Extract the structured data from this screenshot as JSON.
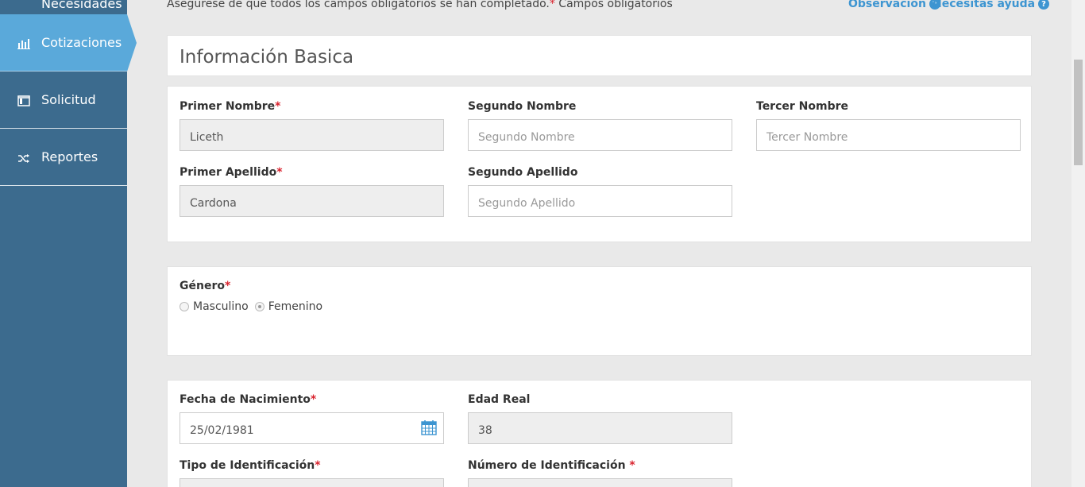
{
  "sidebar": {
    "items": [
      {
        "label": "Necesidades"
      },
      {
        "label": "Cotizaciones",
        "icon": "bar-chart-icon",
        "active": true
      },
      {
        "label": "Solicitud",
        "icon": "window-icon"
      },
      {
        "label": "Reportes",
        "icon": "shuffle-icon"
      }
    ]
  },
  "notice": {
    "text": "Asegúrese de que todos los campos obligatorios se han completado.",
    "req_mark": "*",
    "req_text": " Campos obligatorios"
  },
  "help_links": {
    "observacion": "Observación",
    "ayuda": "Necesitas ayuda",
    "q": "?"
  },
  "basic_info": {
    "title": "Información Basica",
    "primer_nombre": {
      "label": "Primer Nombre",
      "value": "Liceth"
    },
    "segundo_nombre": {
      "label": "Segundo Nombre",
      "placeholder": "Segundo Nombre"
    },
    "tercer_nombre": {
      "label": "Tercer Nombre",
      "placeholder": "Tercer Nombre"
    },
    "primer_apellido": {
      "label": "Primer Apellido",
      "value": "Cardona"
    },
    "segundo_apellido": {
      "label": "Segundo Apellido",
      "placeholder": "Segundo Apellido"
    },
    "req": "*"
  },
  "genero": {
    "label": "Género",
    "options": [
      {
        "label": "Masculino",
        "selected": false
      },
      {
        "label": "Femenino",
        "selected": true
      }
    ]
  },
  "nacimiento": {
    "fecha_label": "Fecha de Nacimiento",
    "fecha_value": "25/02/1981",
    "edad_label": "Edad Real",
    "edad_value": "38",
    "tipo_id_label": "Tipo de Identificación",
    "num_id_label": "Número de Identificación ",
    "req": "*"
  },
  "colors": {
    "sidebar": "#3c6b8e",
    "sidebar_active": "#5aa9da",
    "link": "#3d95d1",
    "required": "#d9232e"
  }
}
